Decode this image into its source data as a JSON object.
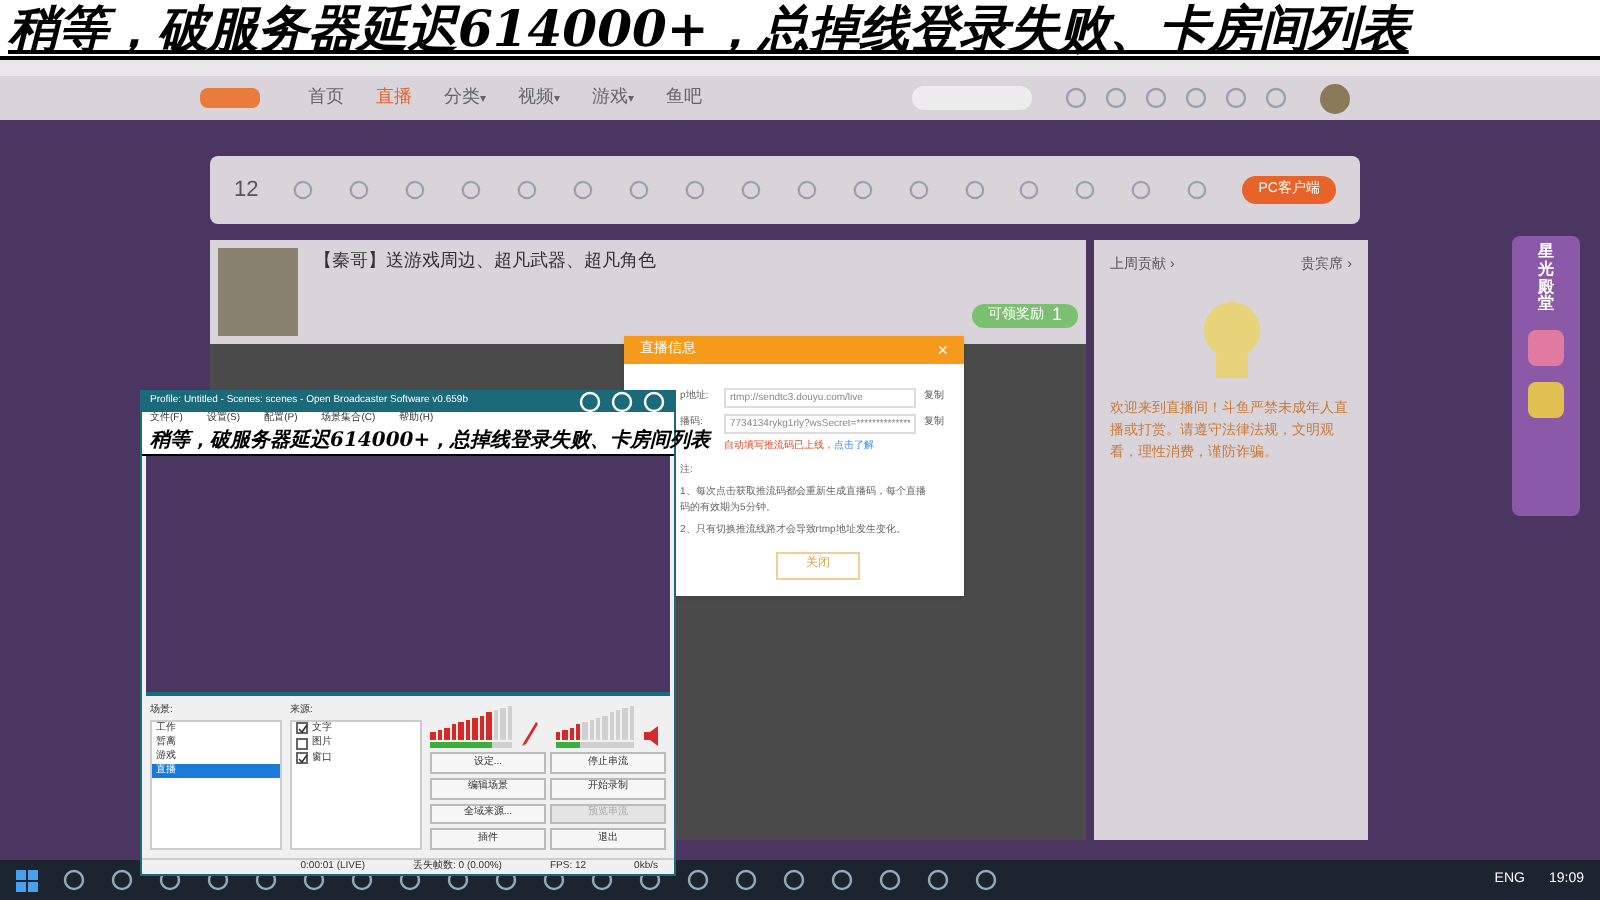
{
  "overlay_banner": {
    "text": "稍等，破服务器延迟614000+，总掉线登录失败、卡房间列表"
  },
  "site_nav": {
    "items": [
      {
        "label": "首页",
        "selected": false
      },
      {
        "label": "直播",
        "selected": true
      },
      {
        "label": "分类",
        "selected": false,
        "caret": "▾"
      },
      {
        "label": "视频",
        "selected": false,
        "caret": "▾"
      },
      {
        "label": "游戏",
        "selected": false,
        "caret": "▾"
      },
      {
        "label": "鱼吧",
        "selected": false
      }
    ]
  },
  "category_bar": {
    "count": "12",
    "client_button": "PC客户端"
  },
  "stream_header": {
    "title": "【秦哥】送游戏周边、超凡武器、超凡角色",
    "reward_label": "可领奖励",
    "reward_count": "1"
  },
  "dialog": {
    "title": "直播信息",
    "close": "×",
    "fields": [
      {
        "label": "p地址:",
        "value": "rtmp://sendtc3.douyu.com/live",
        "action": "复制"
      },
      {
        "label": "播码:",
        "value": "7734134rykg1rly?wsSecret=**************",
        "action": "复制"
      }
    ],
    "warning": "自动填写推流码已上线，",
    "link": "点击了解",
    "notes": [
      "注:",
      "1、每次点击获取推流码都会重新生成直播码，每个直播码的有效期为5分钟。",
      "2、只有切换推流线路才会导致rtmp地址发生变化。"
    ],
    "button": "关闭"
  },
  "chat": {
    "tabs": [
      {
        "label": "上周贡献 ›"
      },
      {
        "label": "贵宾席 ›"
      }
    ],
    "notice": "欢迎来到直播间！斗鱼严禁未成年人直播或打赏。请遵守法律法规，文明观看，理性消费，谨防诈骗。"
  },
  "promo": {
    "title": "星光殿堂"
  },
  "obs": {
    "title": "Profile: Untitled - Scenes: scenes - Open Broadcaster Software v0.659b",
    "menu": [
      "文件(F)",
      "设置(S)",
      "配置(P)",
      "场景集合(C)",
      "帮助(H)"
    ],
    "banner": "稍等，破服务器延迟614000+，总掉线登录失败、卡房间列表",
    "scenes_label": "场景:",
    "sources_label": "来源:",
    "scenes": [
      {
        "label": "工作",
        "selected": false
      },
      {
        "label": "暂离",
        "selected": false
      },
      {
        "label": "游戏",
        "selected": false
      },
      {
        "label": "直播",
        "selected": true
      }
    ],
    "sources": [
      {
        "label": "文字",
        "checked": true
      },
      {
        "label": "图片",
        "checked": false
      },
      {
        "label": "窗口",
        "checked": true
      }
    ],
    "meters": [
      {
        "kind": "mic",
        "level": 0.75
      },
      {
        "kind": "speaker",
        "level": 0.3
      }
    ],
    "buttons": [
      {
        "label": "设定...",
        "disabled": false
      },
      {
        "label": "停止串流",
        "disabled": false
      },
      {
        "label": "编辑场景",
        "disabled": false
      },
      {
        "label": "开始录制",
        "disabled": false
      },
      {
        "label": "全域来源...",
        "disabled": false
      },
      {
        "label": "预览串流",
        "disabled": true
      },
      {
        "label": "插件",
        "disabled": false
      },
      {
        "label": "退出",
        "disabled": false
      }
    ],
    "status": {
      "time": "0:00:01 (LIVE)",
      "dropped": "丢失帧数: 0 (0.00%)",
      "fps": "FPS: 12",
      "rate": "0kb/s"
    }
  },
  "taskbar": {
    "lang": "ENG",
    "time": "19:09"
  }
}
